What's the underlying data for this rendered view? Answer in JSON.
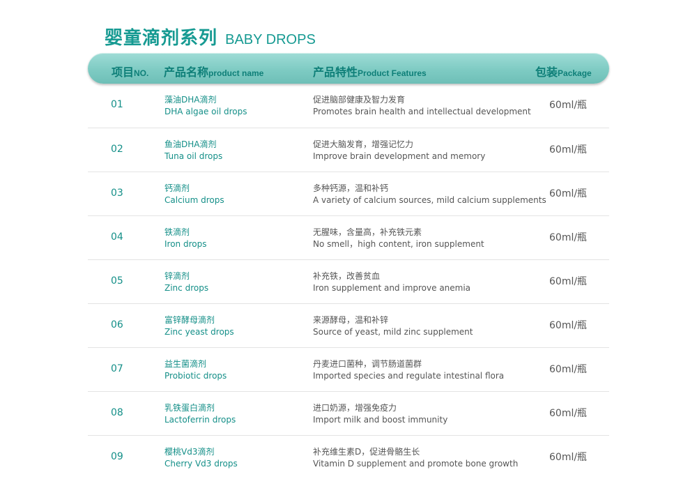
{
  "title": {
    "cn": "婴童滴剂系列",
    "en": "BABY DROPS"
  },
  "header": {
    "no_cn": "项目",
    "no_en": "NO.",
    "name_cn": "产品名称",
    "name_en": "product name",
    "features_cn": "产品特性",
    "features_en": "Product Features",
    "package_cn": "包装",
    "package_en": "Package"
  },
  "colors": {
    "accent": "#169a92",
    "header_bar": "#7ecbc3",
    "text_gray": "#555555"
  },
  "rows": [
    {
      "no": "01",
      "name_cn": "藻油DHA滴剂",
      "name_en": "DHA algae oil drops",
      "feat_cn": "促进脑部健康及智力发育",
      "feat_en": "Promotes brain health and intellectual development",
      "package": "60ml/瓶"
    },
    {
      "no": "02",
      "name_cn": "鱼油DHA滴剂",
      "name_en": "Tuna oil drops",
      "feat_cn": "促进大脑发育，增强记忆力",
      "feat_en": "Improve brain development and memory",
      "package": "60ml/瓶"
    },
    {
      "no": "03",
      "name_cn": "钙滴剂",
      "name_en": "Calcium drops",
      "feat_cn": "多种钙源，温和补钙",
      "feat_en": "A variety of calcium sources, mild calcium supplements",
      "package": "60ml/瓶"
    },
    {
      "no": "04",
      "name_cn": "铁滴剂",
      "name_en": "Iron drops",
      "feat_cn": "无腥味，含量高，补充铁元素",
      "feat_en": "No smell，high content, iron supplement",
      "package": "60ml/瓶"
    },
    {
      "no": "05",
      "name_cn": "锌滴剂",
      "name_en": "Zinc drops",
      "feat_cn": "补充铁，改善贫血",
      "feat_en": "Iron supplement and improve anemia",
      "package": "60ml/瓶"
    },
    {
      "no": "06",
      "name_cn": "富锌酵母滴剂",
      "name_en": "Zinc yeast drops",
      "feat_cn": "来源酵母，温和补锌",
      "feat_en": "Source of yeast, mild zinc supplement",
      "package": "60ml/瓶"
    },
    {
      "no": "07",
      "name_cn": "益生菌滴剂",
      "name_en": "Probiotic drops",
      "feat_cn": "丹麦进口菌种，调节肠道菌群",
      "feat_en": "Imported species and regulate intestinal flora",
      "package": "60ml/瓶"
    },
    {
      "no": "08",
      "name_cn": "乳铁蛋白滴剂",
      "name_en": "Lactoferrin drops",
      "feat_cn": "进口奶源，增强免疫力",
      "feat_en": "Import milk and boost immunity",
      "package": "60ml/瓶"
    },
    {
      "no": "09",
      "name_cn": "樱桃Vd3滴剂",
      "name_en": "Cherry Vd3 drops",
      "feat_cn": "补充维生素D，促进骨骼生长",
      "feat_en": "Vitamin D supplement and promote bone growth",
      "package": "60ml/瓶"
    }
  ]
}
